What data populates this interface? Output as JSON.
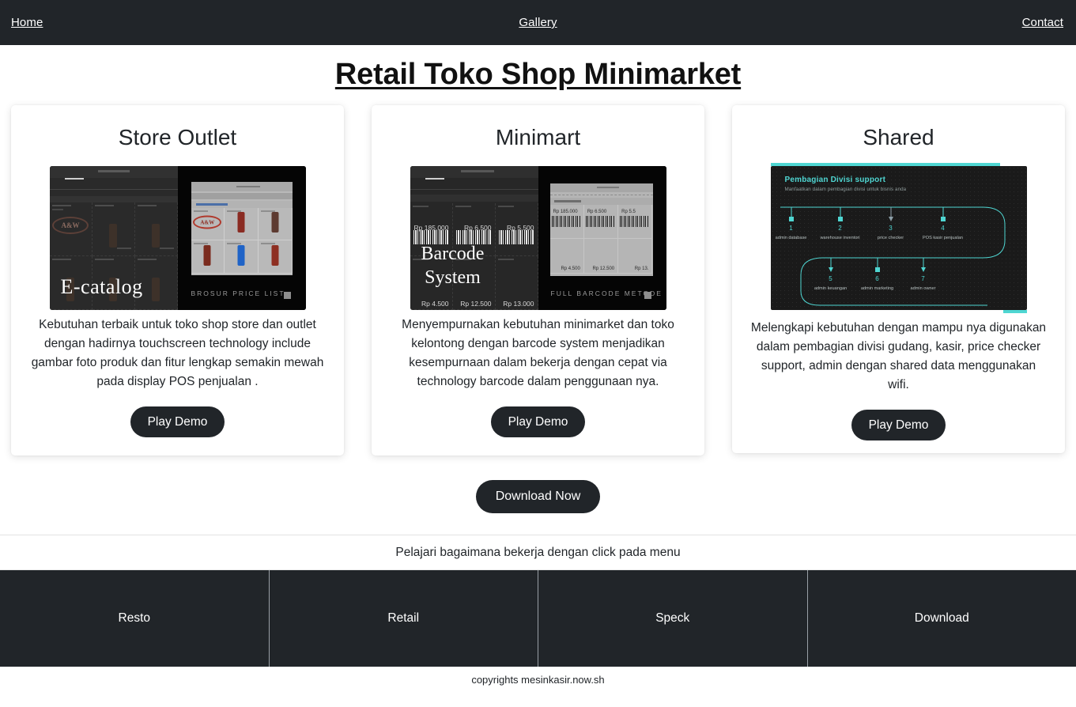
{
  "nav": {
    "home": "Home",
    "gallery": "Gallery",
    "contact": "Contact"
  },
  "page": {
    "title": "Retail Toko Shop Minimarket"
  },
  "cards": [
    {
      "title": "Store Outlet",
      "description": "Kebutuhan terbaik untuk toko shop store dan outlet dengan hadirnya touchscreen technology include gambar foto produk dan fitur lengkap semakin mewah pada display POS penjualan .",
      "button": "Play Demo",
      "thumb": {
        "overlay_text": "E-catalog",
        "caption": "BROSUR PRICE LIST",
        "brand": "A&W"
      }
    },
    {
      "title": "Minimart",
      "description": "Menyempurnakan kebutuhan minimarket dan toko kelontong dengan barcode system menjadikan kesempurnaan dalam bekerja dengan cepat via technology barcode dalam penggunaan nya.",
      "button": "Play Demo",
      "thumb": {
        "overlay_text_line1": "Barcode",
        "overlay_text_line2": "System",
        "caption": "FULL BARCODE METODE",
        "prices": [
          "Rp 185.000",
          "Rp 6.500",
          "Rp 5.500",
          "Rp 4.500",
          "Rp 12.500",
          "Rp 13.000"
        ],
        "doc_prices": [
          "Rp 185.000",
          "Rp 6.500",
          "Rp 5.5",
          "Rp 4.500",
          "Rp 12.500",
          "Rp 13."
        ]
      }
    },
    {
      "title": "Shared",
      "description": "Melengkapi kebutuhan dengan mampu nya digunakan dalam pembagian divisi gudang, kasir, price checker support, admin dengan shared data menggunakan wifi.",
      "button": "Play Demo",
      "thumb": {
        "heading": "Pembagian Divisi support",
        "subheading": "Manfaatkan dalam pembagian divisi untuk bisnis anda",
        "nodes": [
          {
            "num": "1",
            "label": "admin database"
          },
          {
            "num": "2",
            "label": "warehouse inventori"
          },
          {
            "num": "3",
            "label": "price checker"
          },
          {
            "num": "4",
            "label": "POS kasir penjualan"
          },
          {
            "num": "5",
            "label": "admin keuangan"
          },
          {
            "num": "6",
            "label": "admin marketing"
          },
          {
            "num": "7",
            "label": "admin owner"
          }
        ]
      }
    }
  ],
  "download": {
    "button": "Download Now"
  },
  "learn": {
    "text": "Pelajari bagaimana bekerja dengan click pada menu"
  },
  "footer": {
    "items": [
      {
        "label": "Resto"
      },
      {
        "label": "Retail"
      },
      {
        "label": "Speck"
      },
      {
        "label": "Download"
      }
    ],
    "copyright": "copyrights mesinkasir.now.sh"
  },
  "colors": {
    "dark": "#212529",
    "accent_cyan": "#4fd6d2",
    "page_bg": "#ffffff"
  }
}
